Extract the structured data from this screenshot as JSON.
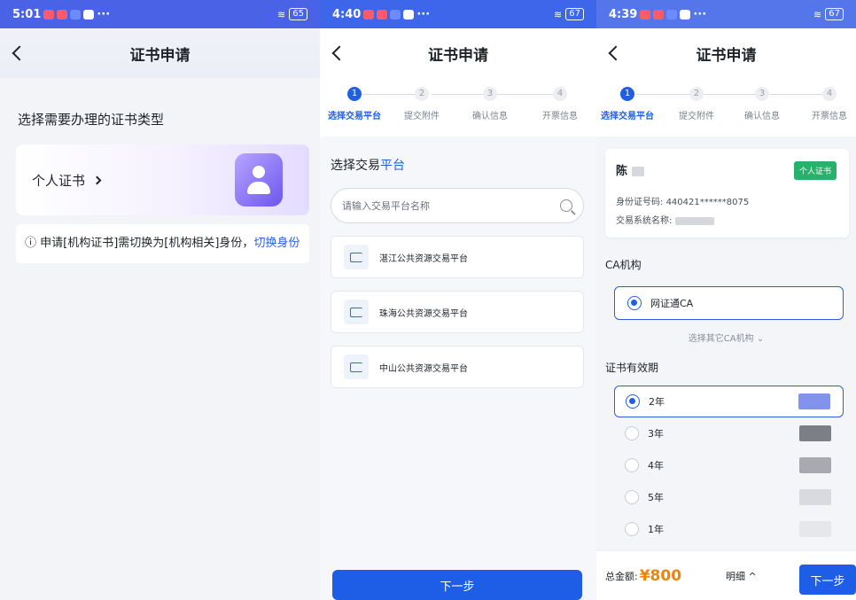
{
  "screen1": {
    "status": {
      "time": "5:01",
      "battery": "65"
    },
    "title": "证书申请",
    "heading": "选择需要办理的证书类型",
    "cert_option": "个人证书",
    "notice_text": "申请[机构证书]需切换为[机构相关]身份，",
    "notice_link": "切换身份"
  },
  "screen2": {
    "status": {
      "time": "4:40",
      "battery": "67"
    },
    "title": "证书申请",
    "steps": [
      {
        "num": "1",
        "label": "选择交易平台"
      },
      {
        "num": "2",
        "label": "提交附件"
      },
      {
        "num": "3",
        "label": "确认信息"
      },
      {
        "num": "4",
        "label": "开票信息"
      }
    ],
    "section_prefix": "选择交易",
    "section_highlight": "平台",
    "search_placeholder": "请输入交易平台名称",
    "platforms": [
      "湛江公共资源交易平台",
      "珠海公共资源交易平台",
      "中山公共资源交易平台"
    ],
    "next_button": "下一步"
  },
  "screen3": {
    "status": {
      "time": "4:39",
      "battery": "67"
    },
    "title": "证书申请",
    "steps": [
      {
        "num": "1",
        "label": "选择交易平台"
      },
      {
        "num": "2",
        "label": "提交附件"
      },
      {
        "num": "3",
        "label": "确认信息"
      },
      {
        "num": "4",
        "label": "开票信息"
      }
    ],
    "holder_name": "陈",
    "badge": "个人证书",
    "id_label": "身份证号码: ",
    "id_value": "440421******8075",
    "system_label": "交易系统名称: ",
    "ca_section": "CA机构",
    "ca_selected": "网证通CA",
    "other_ca": "选择其它CA机构",
    "validity_section": "证书有效期",
    "periods": [
      "2年",
      "3年",
      "4年",
      "5年",
      "1年"
    ],
    "selected_period": "2年",
    "total_label": "总金额: ",
    "total_amount": "¥800",
    "detail_link": "明细",
    "next_button": "下一步",
    "accent_color": "#1f5fe0",
    "amount_color": "#f0830a"
  }
}
